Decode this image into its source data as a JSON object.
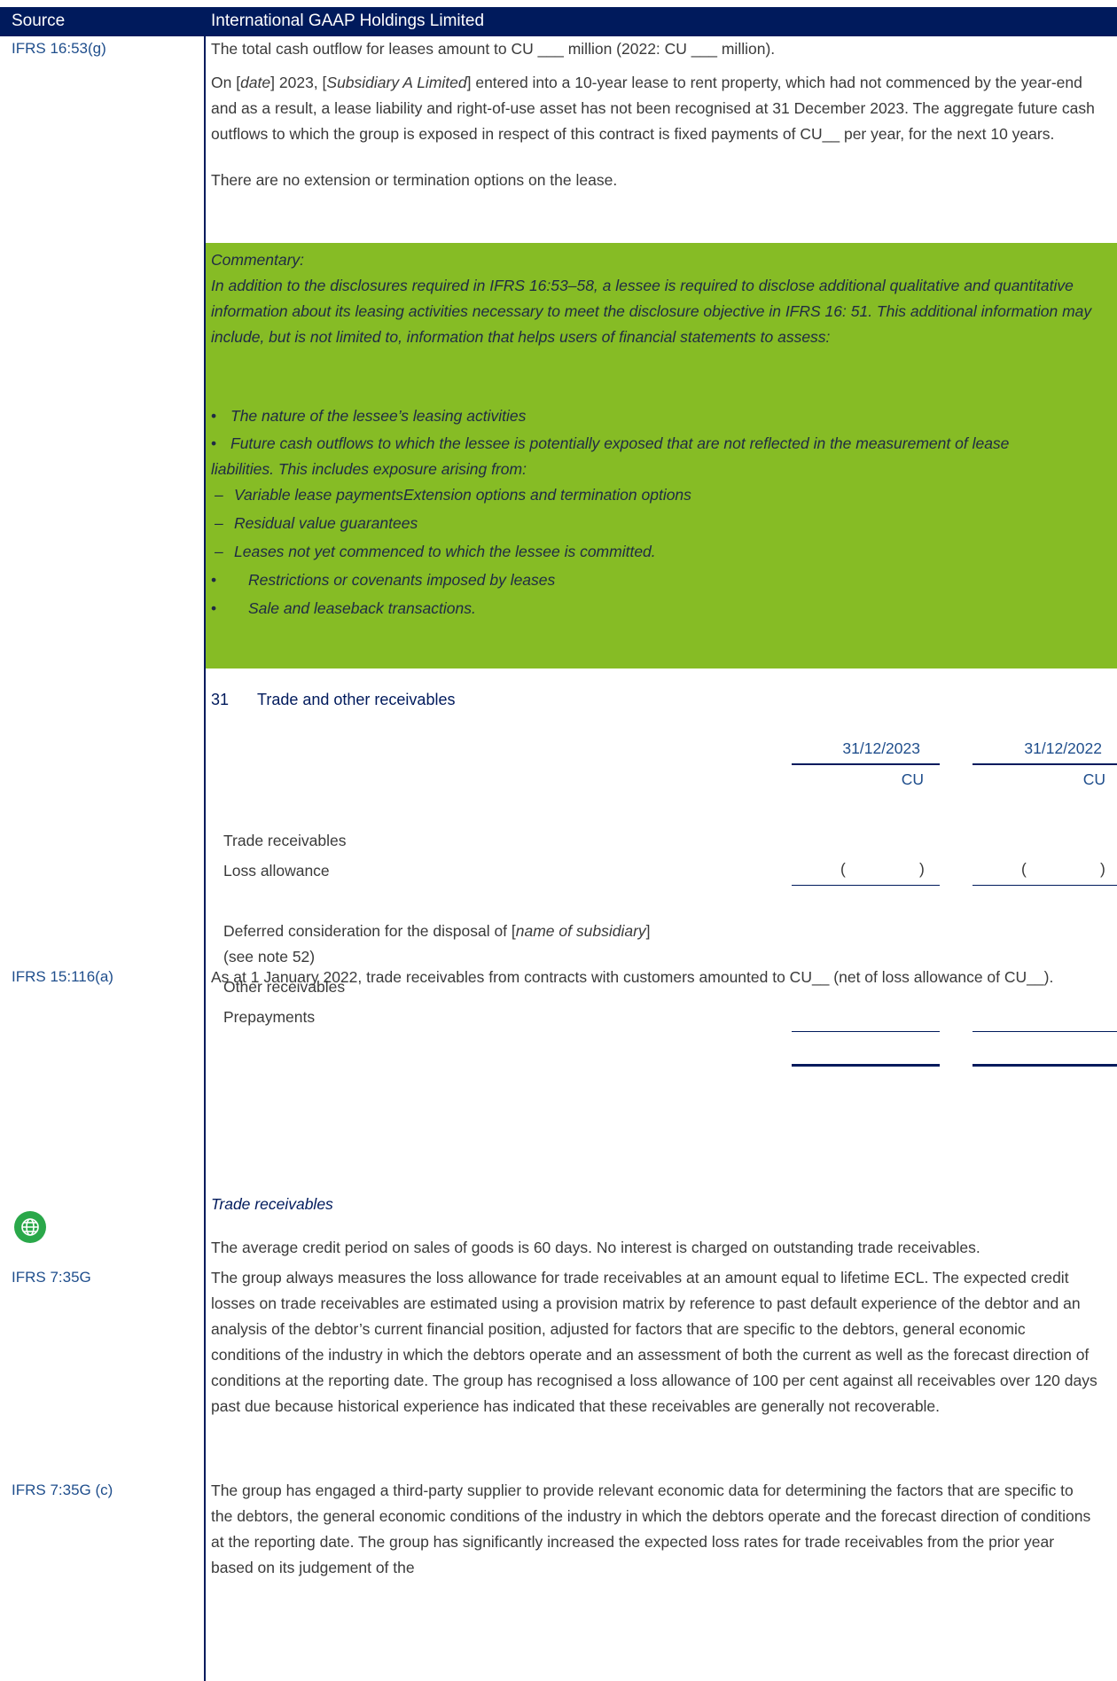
{
  "header": {
    "source": "Source",
    "company": "International GAAP Holdings Limited"
  },
  "sources": {
    "s1": "IFRS 16:53(g)",
    "s2": "IFRS 15:116(a)",
    "s3": "IFRS 7:35G",
    "s4": "IFRS 7:35G (c)"
  },
  "paras": {
    "p1": "The total cash outflow for leases amount to CU ___ million (2022: CU ___ million).",
    "p2_pre": "On [",
    "p2_date": "date",
    "p2_mid": "] 2023, [",
    "p2_sub": "Subsidiary A Limited",
    "p2_post": "] entered into a 10-year lease to rent property, which had not commenced by the year-end and as a result, a lease liability and right-of-use asset has not been recognised at 31 December 2023. The aggregate future cash outflows to which the group is exposed in respect of this contract is fixed payments of CU__ per year, for the next 10 years.",
    "p3": "There are no extension or termination options on the lease.",
    "p4": "As at 1 January 2022, trade receivables from contracts with customers amounted to CU__ (net of loss allowance of CU__).",
    "p5": "The average credit period on sales of goods is 60 days. No interest is charged on outstanding trade receivables.",
    "p6": "The group always measures the loss allowance for trade receivables at an amount equal to lifetime ECL. The expected credit losses on trade receivables are estimated using a provision matrix by reference to past default experience of the debtor and an analysis of the debtor’s current financial position, adjusted for factors that are specific to the debtors, general economic conditions of the industry in which the debtors operate and an assessment of both the current as well as the forecast direction of conditions at the reporting date. The group has recognised a loss allowance of 100 per cent against all receivables over 120 days past due because historical experience has indicated that these receivables are generally not recoverable.",
    "p7": "The group has engaged a third-party supplier to provide relevant economic data for determining the factors that are specific to the debtors, the general economic conditions of the industry in which the debtors operate and the forecast direction of conditions at the reporting date. The group has significantly increased the expected loss rates for trade receivables from the prior year based on its judgement of the"
  },
  "commentary": {
    "title": "Commentary:",
    "intro": "In addition to the disclosures required in IFRS 16:53–58, a lessee is required to disclose additional qualitative and quantitative information about its leasing activities necessary to meet the disclosure objective in IFRS 16: 51. This additional information may include, but is not limited to, information that helps users of financial statements to assess:",
    "b1": "The nature of the lessee’s leasing activities",
    "b2": "Future cash outflows to which the lessee is potentially exposed that are not reflected in the measurement of lease liabilities. This includes exposure arising from:",
    "d1": "Variable lease paymentsExtension options and termination options",
    "d2": "Residual value guarantees",
    "d3": "Leases not yet commenced to which the lessee is committed.",
    "b3": "Restrictions or covenants imposed by leases",
    "b4": "Sale and leaseback transactions."
  },
  "section": {
    "number": "31",
    "title": "Trade and other receivables",
    "col1_date": "31/12/2023",
    "col2_date": "31/12/2022",
    "col_unit": "CU",
    "rows": {
      "r1": "Trade receivables",
      "r2": "Loss allowance",
      "r3_pre": "Deferred consideration for the disposal of [",
      "r3_it": "name of subsidiary",
      "r3_post": "]",
      "r3b": "(see note 52)",
      "r4": "Other receivables",
      "r5": "Prepayments"
    },
    "paren_open": "(",
    "paren_close": ")"
  },
  "subhead": "Trade receivables",
  "icons": {
    "globe": "globe-icon"
  },
  "colors": {
    "navy": "#001a5c",
    "green": "#86bc25",
    "link": "#1f4e8c"
  }
}
